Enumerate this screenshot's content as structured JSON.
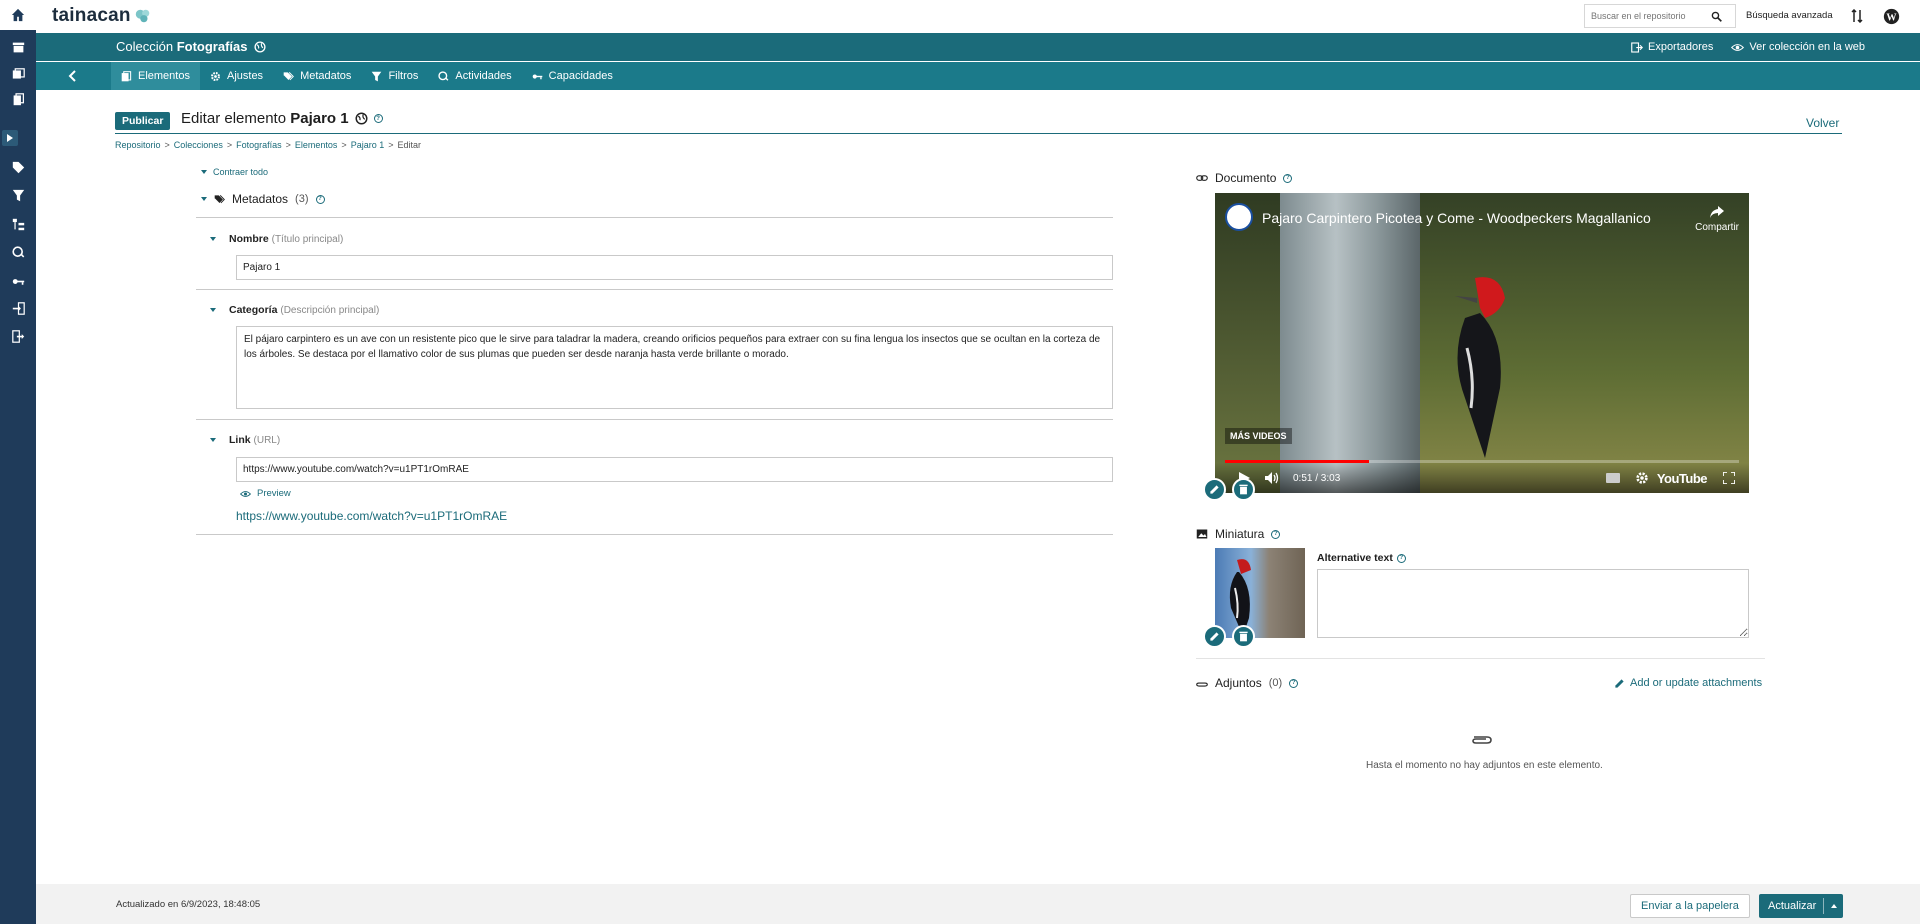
{
  "app": {
    "logo_text": "tainacan"
  },
  "search": {
    "placeholder": "Buscar en el repositorio",
    "advanced_label": "Búsqueda avanzada"
  },
  "collection": {
    "prefix": "Colección",
    "name": "Fotografías",
    "exporters_label": "Exportadores",
    "view_web_label": "Ver colección en la web"
  },
  "tabs": [
    {
      "label": "Elementos",
      "active": true
    },
    {
      "label": "Ajustes"
    },
    {
      "label": "Metadatos"
    },
    {
      "label": "Filtros"
    },
    {
      "label": "Actividades"
    },
    {
      "label": "Capacidades"
    }
  ],
  "page": {
    "status_badge": "Publicar",
    "title_prefix": "Editar elemento",
    "item_name": "Pajaro 1",
    "back_label": "Volver"
  },
  "breadcrumb": [
    "Repositorio",
    "Colecciones",
    "Fotografías",
    "Elementos",
    "Pajaro 1",
    "Editar"
  ],
  "metadata": {
    "collapse_all_label": "Contraer todo",
    "section_label": "Metadatos",
    "count": "(3)",
    "fields": [
      {
        "label": "Nombre",
        "hint": "(Título principal)",
        "value": "Pajaro 1"
      },
      {
        "label": "Categoría",
        "hint": "(Descripción principal)",
        "value": "El pájaro carpintero es un ave con un resistente pico que le sirve para taladrar la madera, creando orificios pequeños para extraer con su fina lengua los insectos que se ocultan en la corteza de los árboles. Se destaca por el llamativo color de sus plumas que pueden ser desde naranja hasta verde brillante o morado."
      },
      {
        "label": "Link",
        "hint": "(URL)",
        "value": "https://www.youtube.com/watch?v=u1PT1rOmRAE"
      }
    ],
    "preview_label": "Preview",
    "link_display": "https://www.youtube.com/watch?v=u1PT1rOmRAE"
  },
  "document": {
    "section_label": "Documento",
    "video_title": "Pajaro Carpintero Picotea y Come - Woodpeckers Magallanico",
    "share_label": "Compartir",
    "more_videos_label": "MÁS VIDEOS",
    "time": "0:51 / 3:03",
    "progress_fraction": 0.28,
    "youtube_label": "YouTube"
  },
  "thumbnail": {
    "section_label": "Miniatura",
    "alt_text_label": "Alternative text",
    "alt_text_value": ""
  },
  "attachments": {
    "section_label": "Adjuntos",
    "count": "(0)",
    "add_label": "Add or update attachments",
    "empty_message": "Hasta el momento no hay adjuntos en este elemento."
  },
  "footer": {
    "updated_text": "Actualizado en 6/9/2023, 18:48:05",
    "trash_label": "Enviar a la papelera",
    "update_label": "Actualizar"
  },
  "colors": {
    "primary": "#1b6b7a",
    "tabs_bg": "#1b7a8a",
    "rail_bg": "#1f3b5a"
  }
}
